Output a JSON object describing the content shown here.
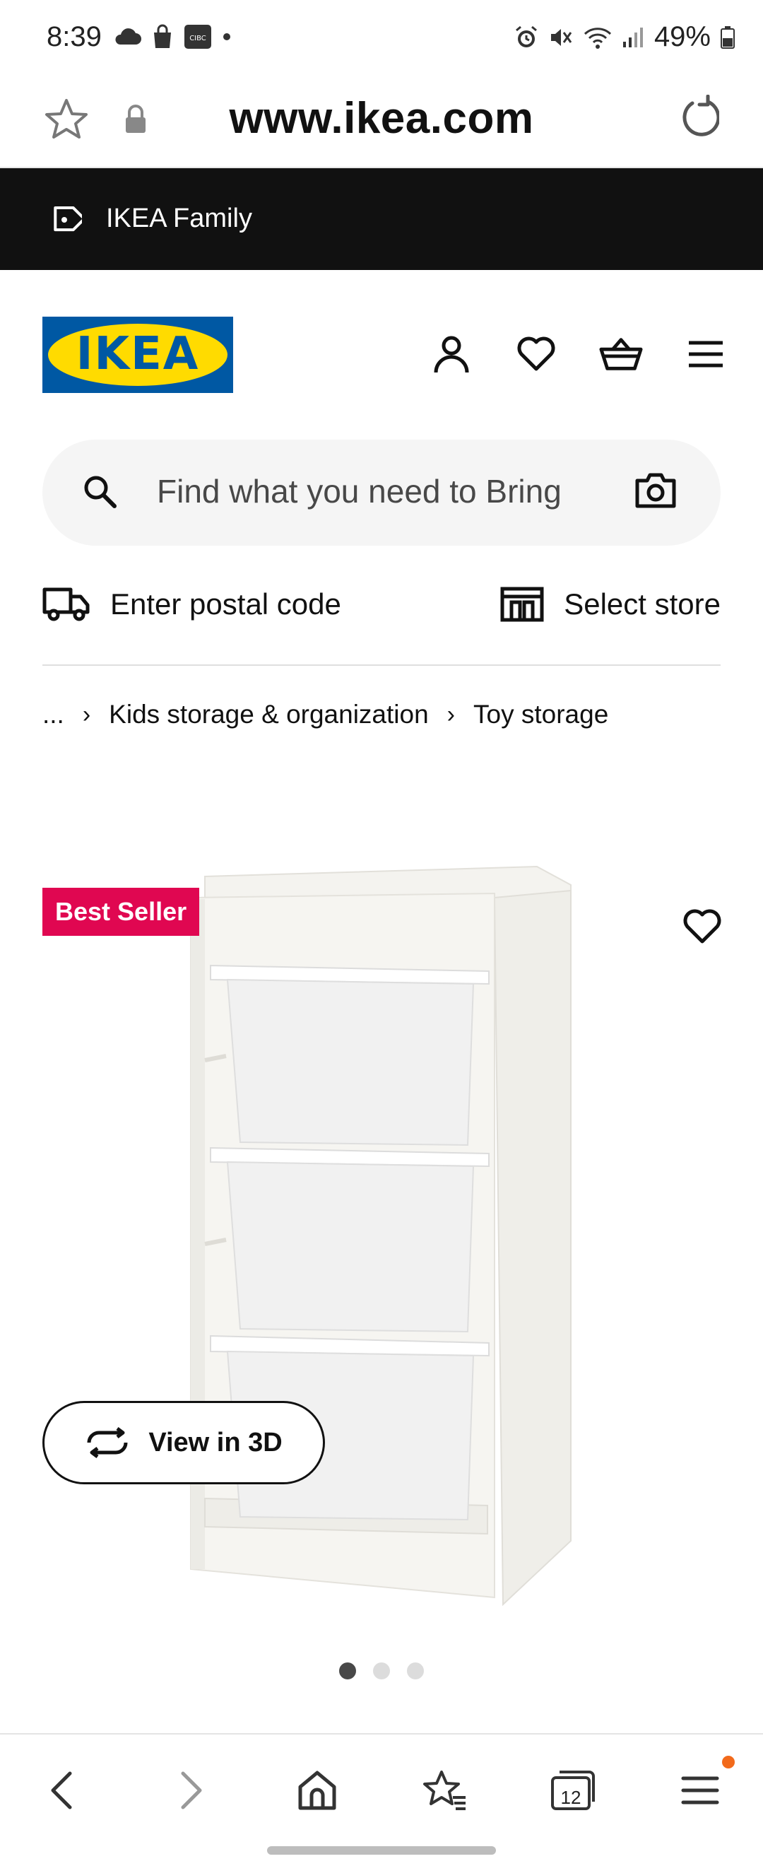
{
  "status_bar": {
    "time": "8:39",
    "battery": "49%"
  },
  "browser": {
    "url": "www.ikea.com",
    "tabs_count": "12"
  },
  "family_banner": {
    "label": "IKEA Family"
  },
  "logo": {
    "text": "IKEA"
  },
  "search": {
    "placeholder": "Find what you need to Bring"
  },
  "location": {
    "postal_label": "Enter postal code",
    "store_label": "Select store"
  },
  "breadcrumb": {
    "ellipsis": "...",
    "items": [
      "Kids storage & organization",
      "Toy storage"
    ]
  },
  "product": {
    "badge": "Best Seller",
    "view3d_label": "View in 3D",
    "image_count": 3,
    "active_image": 1
  },
  "colors": {
    "ikea_blue": "#0058a3",
    "ikea_yellow": "#ffdb00",
    "badge": "#e00751",
    "banner": "#111111",
    "notification_dot": "#f26a1b"
  }
}
